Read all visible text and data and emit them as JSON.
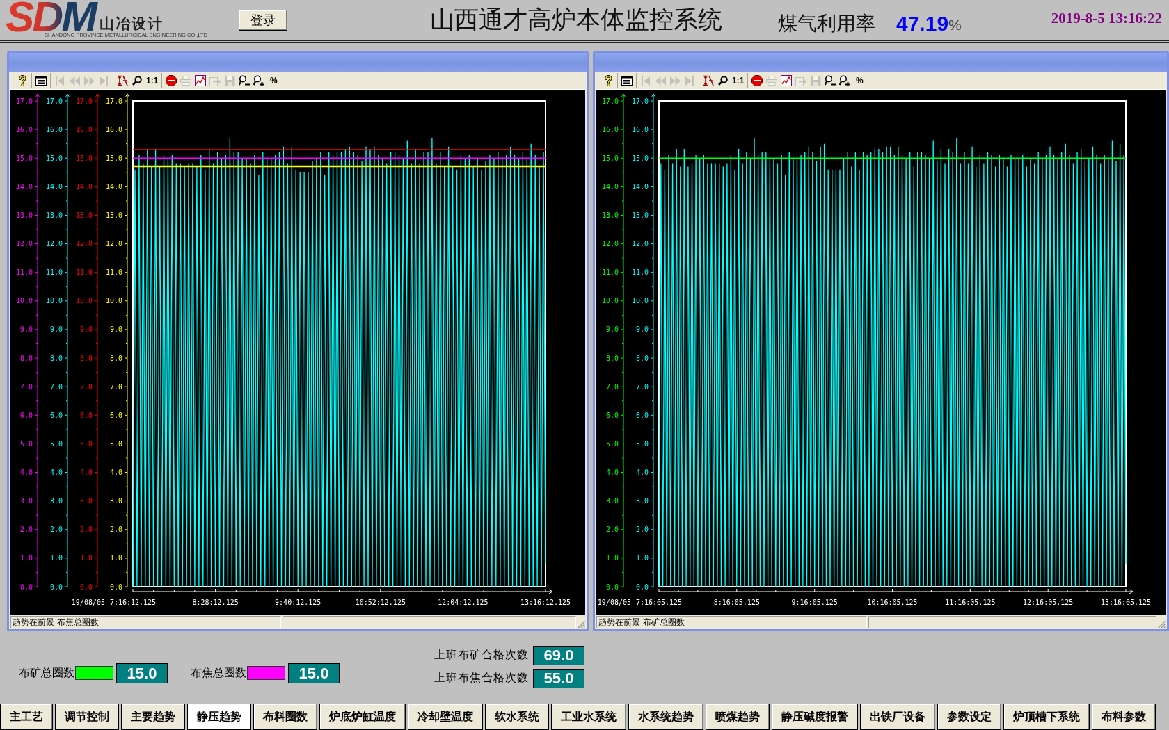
{
  "header": {
    "logo": {
      "mark": "SDM",
      "name": "山冶设计",
      "subtitle": "SHANDONG PROVINCE METALLURGICAL ENGINEERING CO.,LTD"
    },
    "login_button": "登录",
    "title": "山西通才高炉本体监控系统",
    "gas_utilization": {
      "label": "煤气利用率",
      "value": "47.19",
      "unit": "%"
    },
    "datetime": "2019-8-5 13:16:22"
  },
  "trends": [
    {
      "toolbar": [
        [
          {
            "kind": "help",
            "disabled": false
          }
        ],
        [
          {
            "kind": "legend",
            "disabled": false
          }
        ],
        [
          {
            "kind": "first",
            "disabled": true
          },
          {
            "kind": "previous",
            "disabled": true
          },
          {
            "kind": "next",
            "disabled": true
          },
          {
            "kind": "last",
            "disabled": true
          }
        ],
        [
          {
            "kind": "scale",
            "disabled": false
          },
          {
            "kind": "zoom",
            "disabled": false
          },
          {
            "kind": "text",
            "label": "1:1",
            "disabled": false
          }
        ],
        [
          {
            "kind": "stop",
            "disabled": false
          },
          {
            "kind": "print",
            "disabled": true
          },
          {
            "kind": "chart",
            "disabled": false
          },
          {
            "kind": "export",
            "disabled": true
          },
          {
            "kind": "save",
            "disabled": true
          },
          {
            "kind": "zoomout",
            "disabled": false
          },
          {
            "kind": "zoomin",
            "disabled": false
          },
          {
            "kind": "text",
            "label": "%",
            "disabled": false
          }
        ]
      ],
      "axes": [
        {
          "color": "#ff00ff"
        },
        {
          "color": "#00ffff",
          "labels": [
            "17.0",
            "16.0",
            "15.0",
            "14.0",
            "13.0",
            "12.0",
            "11.0",
            "10.0",
            "9.0",
            "8.0",
            "7.0",
            "6.0",
            "5.0",
            "4.0",
            "3.0",
            "2.0",
            "1.0",
            "0.0"
          ]
        },
        {
          "color": "#ff0000",
          "labels": [
            "17.0",
            "16.0",
            "15.0",
            "14.0",
            "13.0",
            "12.0",
            "11.0",
            "10.0",
            "9.0",
            "8.0",
            "7.0",
            "6.0",
            "5.0",
            "4.0",
            "3.0",
            "2.0",
            "1.0",
            "0.0"
          ]
        },
        {
          "color": "#ffff00",
          "labels": [
            "17.0",
            "16.0",
            "15.0",
            "14.0",
            "13.0",
            "12.0",
            "11.0",
            "10.0",
            "9.0",
            "8.0",
            "7.0",
            "6.0",
            "5.0",
            "4.0",
            "3.0",
            "2.0",
            "1.0",
            "0.0"
          ]
        }
      ],
      "date": "19/08/05",
      "chart_data": {
        "type": "line",
        "categories": [
          "7:16:12.125",
          null,
          null,
          null,
          null,
          null,
          null,
          null,
          null,
          null,
          null,
          null,
          null,
          null,
          null,
          null,
          null,
          null,
          null,
          null,
          null,
          null,
          null,
          null,
          null,
          null,
          null,
          null,
          null,
          null,
          null,
          null,
          null,
          null,
          null,
          null,
          null,
          null,
          null,
          null,
          "8:28:12.125",
          null,
          null,
          null,
          null,
          null,
          null,
          null,
          null,
          null,
          null,
          null,
          null,
          null,
          null,
          null,
          null,
          null,
          null,
          null,
          null,
          null,
          null,
          null,
          null,
          null,
          null,
          null,
          null,
          null,
          null,
          null,
          null,
          null,
          null,
          null,
          null,
          null,
          null,
          null,
          "9:40:12.125",
          null,
          null,
          null,
          null,
          null,
          null,
          null,
          null,
          null,
          null,
          null,
          null,
          null,
          null,
          null,
          null,
          null,
          null,
          null,
          null,
          null,
          null,
          null,
          null,
          null,
          null,
          null,
          null,
          null,
          null,
          null,
          null,
          null,
          null,
          null,
          null,
          null,
          null,
          null,
          "10:52:12.125",
          null,
          null,
          null,
          null,
          null,
          null,
          null,
          null,
          null,
          null,
          null,
          null,
          null,
          null,
          null,
          null,
          null,
          null,
          null,
          null,
          null,
          null,
          null,
          null,
          null,
          null,
          null,
          null,
          null,
          null,
          null,
          null,
          null,
          null,
          null,
          null,
          null,
          null,
          null,
          "12:04:12.125",
          null,
          null,
          null,
          null,
          null,
          null,
          null,
          null,
          null,
          null,
          null,
          null,
          null,
          null,
          null,
          null,
          null,
          null,
          null,
          null,
          null,
          null,
          null,
          null,
          null,
          null,
          null,
          null,
          null,
          null,
          null,
          null,
          null,
          null,
          null,
          null,
          null,
          null,
          null,
          "13:16:12.125"
        ],
        "ylim": [
          0,
          17
        ],
        "yticks": [
          {
            "value": 0,
            "label": "0.0"
          },
          {
            "value": 1,
            "label": "1.0"
          },
          {
            "value": 2,
            "label": "2.0"
          },
          {
            "value": 3,
            "label": "3.0"
          },
          {
            "value": 4,
            "label": "4.0"
          },
          {
            "value": 5,
            "label": "5.0"
          },
          {
            "value": 6,
            "label": "6.0"
          },
          {
            "value": 7,
            "label": "7.0"
          },
          {
            "value": 8,
            "label": "8.0"
          },
          {
            "value": 9,
            "label": "9.0"
          },
          {
            "value": 10,
            "label": "10.0"
          },
          {
            "value": 11,
            "label": "11.0"
          },
          {
            "value": 12,
            "label": "12.0"
          },
          {
            "value": 13,
            "label": "13.0"
          },
          {
            "value": 14,
            "label": "14.0"
          },
          {
            "value": 15,
            "label": "15.0"
          },
          {
            "value": 16,
            "label": "16.0"
          },
          {
            "value": 17,
            "label": "17.0"
          }
        ],
        "series": [
          {
            "color": "#00ffff",
            "values": [
              0,
              14.6,
              0,
              15.1,
              0,
              14.8,
              0,
              15.3,
              0,
              14.7,
              0,
              15.3,
              0,
              14.7,
              0,
              15.1,
              0,
              15.0,
              0,
              15.1,
              0,
              14.8,
              0,
              14.8,
              0,
              14.7,
              0,
              14.8,
              0,
              14.8,
              0,
              14.7,
              0,
              15.1,
              0,
              14.6,
              0,
              15.3,
              0,
              14.8,
              0,
              15.2,
              0,
              15.0,
              0,
              15.1,
              0,
              15.7,
              0,
              15.2,
              0,
              15.2,
              0,
              15.0,
              0,
              15.0,
              0,
              14.8,
              0,
              15.1,
              0,
              14.4,
              0,
              15.2,
              0,
              15.0,
              0,
              15.0,
              0,
              15.1,
              0,
              15.2,
              0,
              15.4,
              0,
              14.8,
              0,
              15.4,
              0,
              14.6,
              0,
              14.5,
              0,
              14.5,
              0,
              14.5,
              0,
              14.9,
              0,
              15.0,
              0,
              15.2,
              0,
              14.4,
              0,
              15.2,
              0,
              15.1,
              0,
              15.2,
              0,
              15.2,
              0,
              15.3,
              0,
              15.4,
              0,
              15.2,
              0,
              15.1,
              0,
              14.9,
              0,
              15.4,
              0,
              15.3,
              0,
              15.4,
              0,
              15.1,
              0,
              15.0,
              0,
              14.8,
              0,
              15.2,
              0,
              15.2,
              0,
              15.1,
              0,
              15.0,
              0,
              15.6,
              0,
              14.8,
              0,
              15.3,
              0,
              14.8,
              0,
              15.2,
              0,
              15.2,
              0,
              15.7,
              0,
              14.8,
              0,
              15.2,
              0,
              14.7,
              0,
              15.4,
              0,
              14.7,
              0,
              14.6,
              0,
              15.1,
              0,
              15.0,
              0,
              15.1,
              0,
              14.7,
              0,
              15.0,
              0,
              14.6,
              0,
              14.9,
              0,
              15.1,
              0,
              15.0,
              0,
              15.2,
              0,
              15.0,
              0,
              15.1,
              0,
              15.4,
              0,
              15.1,
              0,
              15.0,
              0,
              15.2,
              0,
              15.0,
              0,
              15.5,
              0,
              15.1,
              0,
              14.7,
              0,
              15.2,
              0.8
            ]
          }
        ],
        "ref_lines": [
          {
            "axis": "y",
            "value": 15.3,
            "color": "#ff0000"
          },
          {
            "axis": "y",
            "value": 15.0,
            "color": "#ff00ff"
          },
          {
            "axis": "y",
            "value": 14.7,
            "color": "#ffff00"
          }
        ]
      },
      "status_bar": {
        "text": "趋势在前景 布焦总圈数"
      }
    },
    {
      "toolbar": [
        [
          {
            "kind": "help",
            "disabled": false
          }
        ],
        [
          {
            "kind": "legend",
            "disabled": false
          }
        ],
        [
          {
            "kind": "first",
            "disabled": true
          },
          {
            "kind": "previous",
            "disabled": true
          },
          {
            "kind": "next",
            "disabled": true
          },
          {
            "kind": "last",
            "disabled": true
          }
        ],
        [
          {
            "kind": "scale",
            "disabled": false
          },
          {
            "kind": "zoom",
            "disabled": false
          },
          {
            "kind": "text",
            "label": "1:1",
            "disabled": false
          }
        ],
        [
          {
            "kind": "stop",
            "disabled": false
          },
          {
            "kind": "print",
            "disabled": true
          },
          {
            "kind": "chart",
            "disabled": false
          },
          {
            "kind": "export",
            "disabled": true
          },
          {
            "kind": "save",
            "disabled": true
          },
          {
            "kind": "zoomout",
            "disabled": false
          },
          {
            "kind": "zoomin",
            "disabled": false
          },
          {
            "kind": "text",
            "label": "%",
            "disabled": false
          }
        ]
      ],
      "axes": [
        {
          "color": "#00ff00"
        },
        {
          "color": "#00ffff",
          "labels": [
            "17.0",
            "16.0",
            "15.0",
            "14.0",
            "13.0",
            "12.0",
            "11.0",
            "10.0",
            "9.0",
            "8.0",
            "7.0",
            "6.0",
            "5.0",
            "4.0",
            "3.0",
            "2.0",
            "1.0",
            "0.0"
          ]
        }
      ],
      "date": "19/08/05",
      "chart_data": {
        "type": "line",
        "categories": [
          "7:16:05.125",
          null,
          null,
          null,
          null,
          null,
          null,
          null,
          null,
          null,
          null,
          null,
          null,
          null,
          null,
          null,
          null,
          null,
          null,
          null,
          null,
          null,
          null,
          null,
          null,
          null,
          null,
          null,
          null,
          null,
          null,
          null,
          null,
          null,
          null,
          null,
          null,
          null,
          null,
          null,
          "8:16:05.125",
          null,
          null,
          null,
          null,
          null,
          null,
          null,
          null,
          null,
          null,
          null,
          null,
          null,
          null,
          null,
          null,
          null,
          null,
          null,
          null,
          null,
          null,
          null,
          null,
          null,
          null,
          null,
          null,
          null,
          null,
          null,
          null,
          null,
          null,
          null,
          null,
          null,
          null,
          null,
          "9:16:05.125",
          null,
          null,
          null,
          null,
          null,
          null,
          null,
          null,
          null,
          null,
          null,
          null,
          null,
          null,
          null,
          null,
          null,
          null,
          null,
          null,
          null,
          null,
          null,
          null,
          null,
          null,
          null,
          null,
          null,
          null,
          null,
          null,
          null,
          null,
          null,
          null,
          null,
          null,
          null,
          "10:16:05.125",
          null,
          null,
          null,
          null,
          null,
          null,
          null,
          null,
          null,
          null,
          null,
          null,
          null,
          null,
          null,
          null,
          null,
          null,
          null,
          null,
          null,
          null,
          null,
          null,
          null,
          null,
          null,
          null,
          null,
          null,
          null,
          null,
          null,
          null,
          null,
          null,
          null,
          null,
          null,
          "11:16:05.125",
          null,
          null,
          null,
          null,
          null,
          null,
          null,
          null,
          null,
          null,
          null,
          null,
          null,
          null,
          null,
          null,
          null,
          null,
          null,
          null,
          null,
          null,
          null,
          null,
          null,
          null,
          null,
          null,
          null,
          null,
          null,
          null,
          null,
          null,
          null,
          null,
          null,
          null,
          null,
          "12:16:05.125",
          null,
          null,
          null,
          null,
          null,
          null,
          null,
          null,
          null,
          null,
          null,
          null,
          null,
          null,
          null,
          null,
          null,
          null,
          null,
          null,
          null,
          null,
          null,
          null,
          null,
          null,
          null,
          null,
          null,
          null,
          null,
          null,
          null,
          null,
          null,
          null,
          null,
          null,
          null,
          "13:16:05.125"
        ],
        "ylim": [
          0,
          17
        ],
        "yticks": [
          {
            "value": 0,
            "label": "0.0"
          },
          {
            "value": 1,
            "label": "1.0"
          },
          {
            "value": 2,
            "label": "2.0"
          },
          {
            "value": 3,
            "label": "3.0"
          },
          {
            "value": 4,
            "label": "4.0"
          },
          {
            "value": 5,
            "label": "5.0"
          },
          {
            "value": 6,
            "label": "6.0"
          },
          {
            "value": 7,
            "label": "7.0"
          },
          {
            "value": 8,
            "label": "8.0"
          },
          {
            "value": 9,
            "label": "9.0"
          },
          {
            "value": 10,
            "label": "10.0"
          },
          {
            "value": 11,
            "label": "11.0"
          },
          {
            "value": 12,
            "label": "12.0"
          },
          {
            "value": 13,
            "label": "13.0"
          },
          {
            "value": 14,
            "label": "14.0"
          },
          {
            "value": 15,
            "label": "15.0"
          },
          {
            "value": 16,
            "label": "16.0"
          },
          {
            "value": 17,
            "label": "17.0"
          }
        ],
        "series": [
          {
            "color": "#00ffff",
            "values": [
              0,
              14.8,
              0,
              14.6,
              0,
              15.1,
              0,
              14.8,
              0,
              15.3,
              0,
              14.7,
              0,
              15.3,
              0,
              14.7,
              0,
              14.8,
              0,
              15.1,
              0,
              15.0,
              0,
              15.1,
              0,
              14.8,
              0,
              14.8,
              0,
              14.8,
              0,
              14.8,
              0,
              14.7,
              0,
              14.8,
              0,
              15.1,
              0,
              14.6,
              0,
              15.3,
              0,
              14.8,
              0,
              15.2,
              0,
              15.0,
              0,
              15.7,
              0,
              15.1,
              0,
              15.2,
              0,
              15.2,
              0,
              15.0,
              0,
              15.0,
              0,
              14.8,
              0,
              15.1,
              0,
              14.4,
              0,
              15.2,
              0,
              15.0,
              0,
              15.0,
              0,
              15.1,
              0,
              15.2,
              0,
              15.4,
              0,
              15.2,
              0,
              14.9,
              0,
              15.4,
              0,
              15.5,
              0,
              14.6,
              0,
              14.6,
              0,
              14.6,
              0,
              14.6,
              0,
              15.0,
              0,
              15.2,
              0,
              14.7,
              0,
              15.2,
              0,
              14.6,
              0,
              15.2,
              0,
              15.1,
              0,
              15.2,
              0,
              15.3,
              0,
              15.3,
              0,
              15.2,
              0,
              15.4,
              0,
              15.4,
              0,
              15.1,
              0,
              15.4,
              0,
              15.1,
              0,
              15.0,
              0,
              15.2,
              0,
              14.7,
              0,
              15.2,
              0,
              15.2,
              0,
              15.1,
              0,
              15.0,
              0,
              15.6,
              0,
              14.9,
              0,
              15.3,
              0,
              14.8,
              0,
              15.3,
              0,
              15.2,
              0,
              15.7,
              0,
              14.8,
              0,
              15.2,
              0,
              14.8,
              0,
              15.4,
              0,
              14.7,
              0,
              15.1,
              0,
              14.8,
              0,
              15.2,
              0,
              15.1,
              0,
              14.7,
              0,
              15.1,
              0,
              15.0,
              0,
              14.7,
              0,
              15.1,
              0,
              15.0,
              0,
              15.0,
              0,
              15.1,
              0,
              14.7,
              0,
              15.0,
              0,
              14.8,
              0,
              15.2,
              0,
              15.0,
              0,
              15.1,
              0,
              15.4,
              0,
              15.1,
              0,
              15.0,
              0,
              15.2,
              0,
              15.5,
              0,
              15.1,
              0,
              14.8,
              0,
              15.2,
              0,
              15.3,
              0,
              14.9,
              0,
              15.0,
              0,
              15.4,
              0,
              15.1,
              0,
              14.8,
              0,
              15.1,
              0,
              15.0,
              0,
              15.6,
              0,
              14.9,
              0,
              15.5,
              0,
              15.1,
              0.8
            ]
          }
        ],
        "ref_lines": [
          {
            "axis": "y",
            "value": 15.0,
            "color": "#00ff00"
          }
        ]
      },
      "status_bar": {
        "text": "趋势在前景 布矿总圈数"
      }
    }
  ],
  "indicators": [
    {
      "label": "布矿总圈数",
      "color": "#00ff00",
      "value": "15.0"
    },
    {
      "label": "布焦总圈数",
      "color": "#ff00ff",
      "value": "15.0"
    }
  ],
  "shift_counts": [
    {
      "label": "上班布矿合格次数",
      "value": "69.0"
    },
    {
      "label": "上班布焦合格次数",
      "value": "55.0"
    }
  ],
  "nav_buttons": [
    {
      "label": "主工艺",
      "selected": false
    },
    {
      "label": "调节控制",
      "selected": false
    },
    {
      "label": "主要趋势",
      "selected": false
    },
    {
      "label": "静压趋势",
      "selected": true
    },
    {
      "label": "布料圈数",
      "selected": false
    },
    {
      "label": "炉底炉缸温度",
      "selected": false
    },
    {
      "label": "冷却壁温度",
      "selected": false
    },
    {
      "label": "软水系统",
      "selected": false
    },
    {
      "label": "工业水系统",
      "selected": false
    },
    {
      "label": "水系统趋势",
      "selected": false
    },
    {
      "label": "喷煤趋势",
      "selected": false
    },
    {
      "label": "静压碱度报警",
      "selected": false
    },
    {
      "label": "出铁厂设备",
      "selected": false
    },
    {
      "label": "参数设定",
      "selected": false
    },
    {
      "label": "炉顶槽下系统",
      "selected": false
    },
    {
      "label": "布料参数",
      "selected": false
    }
  ]
}
